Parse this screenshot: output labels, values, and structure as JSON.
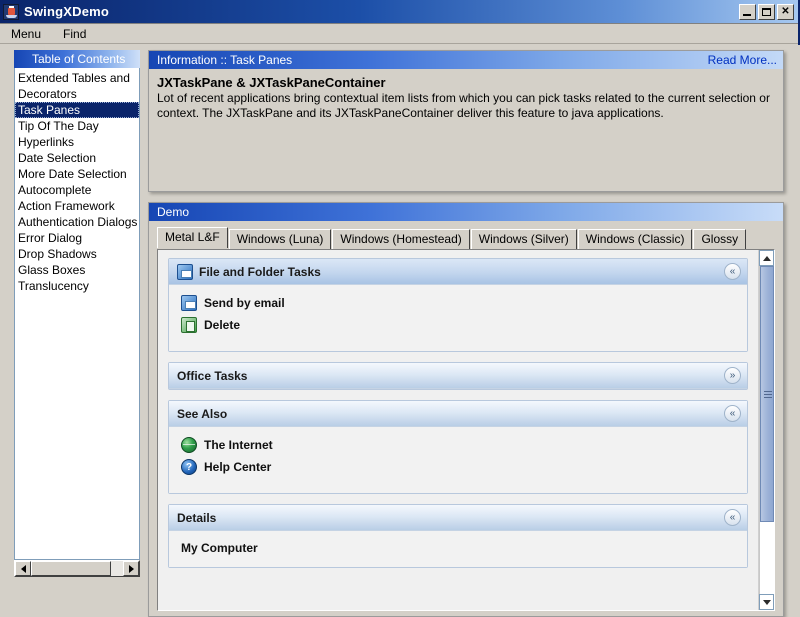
{
  "window": {
    "title": "SwingXDemo",
    "icon": "java-cup-icon",
    "buttons": {
      "minimize": "_",
      "maximize": "□",
      "close": "✕"
    }
  },
  "menubar": {
    "items": [
      {
        "label": "Menu"
      },
      {
        "label": "Find"
      }
    ]
  },
  "toc": {
    "header": "Table of Contents",
    "items": [
      {
        "label": "Extended Tables and Decorators",
        "selected": false,
        "wrap": true
      },
      {
        "label": "Task Panes",
        "selected": true,
        "wrap": false
      },
      {
        "label": "Tip Of The Day",
        "selected": false,
        "wrap": false
      },
      {
        "label": "Hyperlinks",
        "selected": false,
        "wrap": false
      },
      {
        "label": "Date Selection",
        "selected": false,
        "wrap": false
      },
      {
        "label": "More Date Selection",
        "selected": false,
        "wrap": false
      },
      {
        "label": "Autocomplete",
        "selected": false,
        "wrap": false
      },
      {
        "label": "Action Framework",
        "selected": false,
        "wrap": false
      },
      {
        "label": "Authentication Dialogs",
        "selected": false,
        "wrap": false
      },
      {
        "label": "Error Dialog",
        "selected": false,
        "wrap": false
      },
      {
        "label": "Drop Shadows",
        "selected": false,
        "wrap": false
      },
      {
        "label": "Glass Boxes",
        "selected": false,
        "wrap": false
      },
      {
        "label": "Translucency",
        "selected": false,
        "wrap": false
      }
    ]
  },
  "info": {
    "header_title": "Information :: Task Panes",
    "read_more": "Read More...",
    "body_title": "JXTaskPane & JXTaskPaneContainer",
    "body_text": "Lot of recent applications bring contextual item lists from which you can pick tasks related to the current selection or context. The JXTaskPane and its JXTaskPaneContainer deliver this feature to java applications."
  },
  "demo": {
    "header_title": "Demo",
    "tabs": [
      {
        "label": "Metal L&F",
        "active": true
      },
      {
        "label": "Windows (Luna)",
        "active": false
      },
      {
        "label": "Windows (Homestead)",
        "active": false
      },
      {
        "label": "Windows (Silver)",
        "active": false
      },
      {
        "label": "Windows (Classic)",
        "active": false
      },
      {
        "label": "Glossy",
        "active": false
      }
    ],
    "taskpanes": [
      {
        "title": "File and Folder Tasks",
        "icon": "folder-mail-icon",
        "expanded": true,
        "toggle_glyph": "«",
        "items": [
          {
            "label": "Send by email",
            "icon": "folder-mail-icon"
          },
          {
            "label": "Delete",
            "icon": "delete-icon"
          }
        ]
      },
      {
        "title": "Office Tasks",
        "icon": "",
        "expanded": false,
        "toggle_glyph": "»",
        "items": []
      },
      {
        "title": "See Also",
        "icon": "",
        "expanded": true,
        "toggle_glyph": "«",
        "items": [
          {
            "label": "The Internet",
            "icon": "globe-icon"
          },
          {
            "label": "Help Center",
            "icon": "help-icon"
          }
        ]
      },
      {
        "title": "Details",
        "icon": "",
        "expanded": true,
        "toggle_glyph": "«",
        "detail_text": "My Computer",
        "items": []
      }
    ]
  },
  "colors": {
    "title_bar_start": "#0a246a",
    "title_bar_end": "#a6c8f0",
    "panel_header_start": "#1646b4",
    "panel_header_end": "#c3d9f7",
    "selection": "#0a246a",
    "link": "#0030c0",
    "window_bg": "#d4d0c8",
    "taskpane_border": "#b8c8dd"
  }
}
